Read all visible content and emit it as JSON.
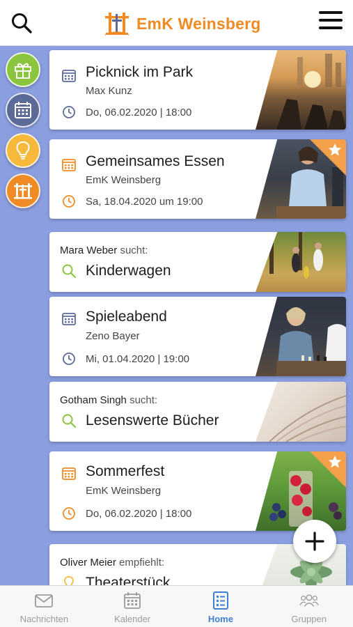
{
  "header": {
    "brand_name": "EmK Weinsberg",
    "brand_color": "#f08a24"
  },
  "rail": [
    {
      "icon": "gift-icon",
      "color": "#8bc53f"
    },
    {
      "icon": "calendar-icon",
      "color": "#5c6a98"
    },
    {
      "icon": "lightbulb-icon",
      "color": "#f6b93b"
    },
    {
      "icon": "church-icon",
      "color": "#f08a24"
    }
  ],
  "cards": [
    {
      "type": "event",
      "title": "Picknick im Park",
      "organizer": "Max Kunz",
      "date": "Do, 06.02.2020 | 18:00",
      "icon_color": "#5c6a98",
      "featured": false
    },
    {
      "type": "event",
      "title": "Gemeinsames Essen",
      "organizer": "EmK Weinsberg",
      "date": "Sa, 18.04.2020 um 19:00",
      "icon_color": "#f08a24",
      "featured": true
    },
    {
      "type": "search",
      "person": "Mara Weber",
      "verb": "sucht:",
      "title": "Kinderwagen",
      "icon_color": "#8bc53f"
    },
    {
      "type": "event",
      "title": "Spieleabend",
      "organizer": "Zeno Bayer",
      "date": "Mi, 01.04.2020 | 19:00",
      "icon_color": "#5c6a98",
      "featured": false
    },
    {
      "type": "search",
      "person": "Gotham Singh",
      "verb": "sucht:",
      "title": "Lesenswerte Bücher",
      "icon_color": "#8bc53f"
    },
    {
      "type": "event",
      "title": "Sommerfest",
      "organizer": "EmK Weinsberg",
      "date": "Do, 06.02.2020 | 18:00",
      "icon_color": "#f08a24",
      "featured": true
    },
    {
      "type": "recommend",
      "person": "Oliver Meier",
      "verb": "empfiehlt:",
      "title": "Theaterstück",
      "icon_color": "#f6b93b"
    }
  ],
  "nav": [
    {
      "label": "Nachrichten",
      "icon": "mail-icon",
      "active": false
    },
    {
      "label": "Kalender",
      "icon": "calendar-icon",
      "active": false
    },
    {
      "label": "Home",
      "icon": "list-icon",
      "active": true
    },
    {
      "label": "Gruppen",
      "icon": "group-icon",
      "active": false
    }
  ],
  "colors": {
    "background": "#8b9ee0",
    "active_nav": "#3f7fd6",
    "featured_star": "#f5a04a"
  }
}
